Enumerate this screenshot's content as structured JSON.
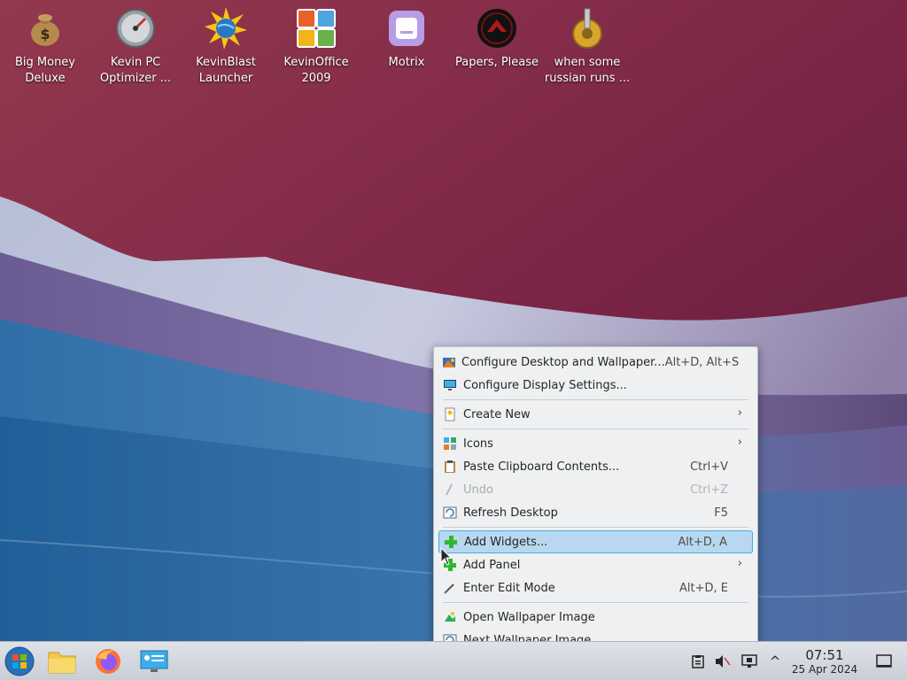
{
  "desktop": {
    "icons": [
      {
        "label": "Big Money Deluxe",
        "icon": "money-bag-icon"
      },
      {
        "label": "Kevin PC Optimizer ...",
        "icon": "speedometer-icon"
      },
      {
        "label": "KevinBlast Launcher",
        "icon": "globe-burst-icon"
      },
      {
        "label": "KevinOffice 2009",
        "icon": "office-logo-icon"
      },
      {
        "label": "Motrix",
        "icon": "motrix-icon"
      },
      {
        "label": "Papers, Please",
        "icon": "papers-please-icon"
      },
      {
        "label": "when some russian runs ...",
        "icon": "golden-gear-icon"
      }
    ]
  },
  "context_menu": {
    "items": [
      {
        "label": "Configure Desktop and Wallpaper...",
        "shortcut": "Alt+D, Alt+S",
        "icon": "palette-icon"
      },
      {
        "label": "Configure Display Settings...",
        "shortcut": "",
        "icon": "display-icon"
      },
      {
        "label": "Create New",
        "shortcut": "",
        "icon": "new-document-icon",
        "submenu": true
      },
      {
        "label": "Icons",
        "shortcut": "",
        "icon": "icon-grid-icon",
        "submenu": true
      },
      {
        "label": "Paste Clipboard Contents...",
        "shortcut": "Ctrl+V",
        "icon": "clipboard-icon"
      },
      {
        "label": "Undo",
        "shortcut": "Ctrl+Z",
        "icon": "undo-icon",
        "disabled": true
      },
      {
        "label": "Refresh Desktop",
        "shortcut": "F5",
        "icon": "refresh-icon"
      },
      {
        "label": "Add Widgets...",
        "shortcut": "Alt+D, A",
        "icon": "plus-icon",
        "highlighted": true
      },
      {
        "label": "Add Panel",
        "shortcut": "",
        "icon": "plus-icon",
        "submenu": true
      },
      {
        "label": "Enter Edit Mode",
        "shortcut": "Alt+D, E",
        "icon": "edit-icon"
      },
      {
        "label": "Open Wallpaper Image",
        "shortcut": "",
        "icon": "image-icon"
      },
      {
        "label": "Next Wallpaper Image",
        "shortcut": "",
        "icon": "next-image-icon"
      }
    ],
    "submenu_arrow": "›"
  },
  "taskbar": {
    "clock_time": "07:51",
    "clock_date": "25 Apr 2024",
    "tray_expand_glyph": "^"
  },
  "colors": {
    "menu_bg": "#eff0f1",
    "highlight": "#b8d8ef",
    "highlight_border": "#3daee9",
    "taskbar_bg": "#d5dae0"
  }
}
